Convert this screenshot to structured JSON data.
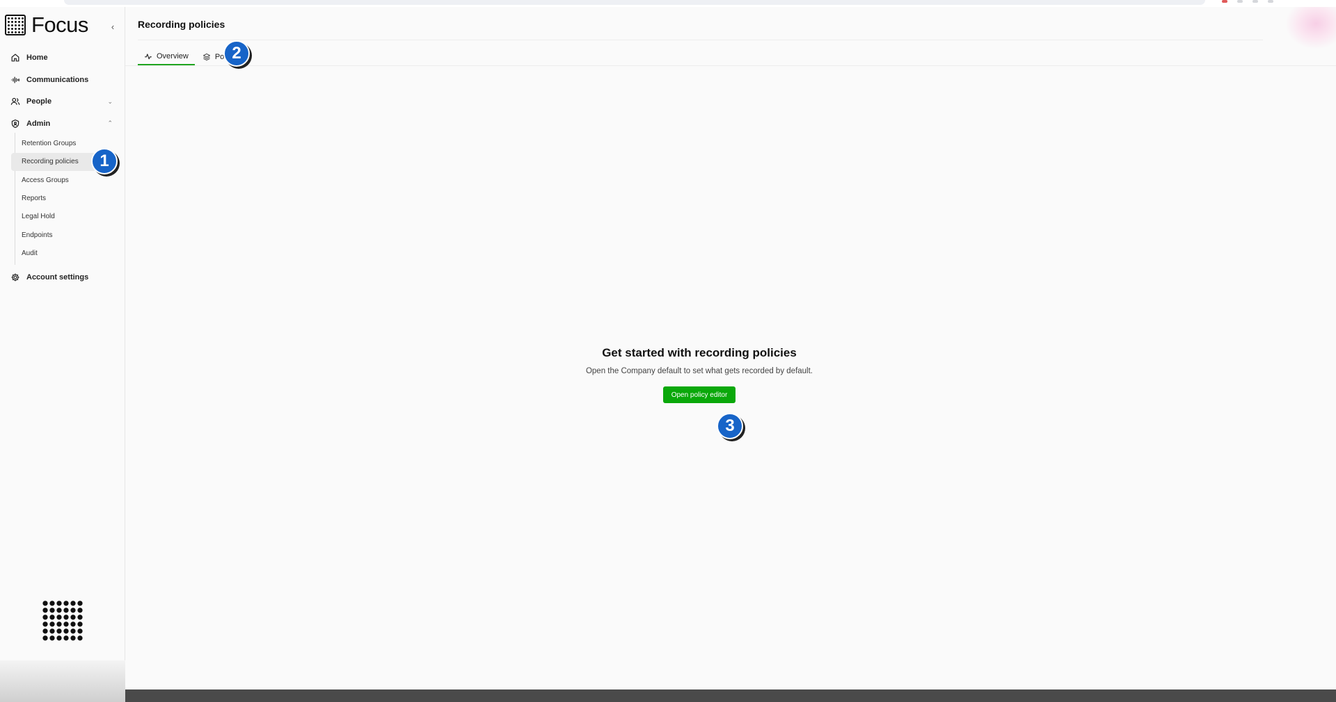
{
  "brand": {
    "name": "Focus"
  },
  "sidebar": {
    "collapse_glyph": "‹",
    "items": [
      {
        "id": "home",
        "label": "Home",
        "icon": "home-icon"
      },
      {
        "id": "communications",
        "label": "Communications",
        "icon": "waveform-icon"
      },
      {
        "id": "people",
        "label": "People",
        "icon": "users-icon",
        "chevron": "⌄"
      },
      {
        "id": "admin",
        "label": "Admin",
        "icon": "shield-icon",
        "chevron": "⌃"
      }
    ],
    "admin_subitems": [
      {
        "label": "Retention Groups",
        "active": false
      },
      {
        "label": "Recording policies",
        "active": true
      },
      {
        "label": "Access Groups",
        "active": false
      },
      {
        "label": "Reports",
        "active": false
      },
      {
        "label": "Legal Hold",
        "active": false
      },
      {
        "label": "Endpoints",
        "active": false
      },
      {
        "label": "Audit",
        "active": false
      }
    ],
    "account": {
      "label": "Account settings",
      "icon": "settings-icon"
    }
  },
  "page": {
    "title": "Recording policies",
    "tabs": [
      {
        "label": "Overview",
        "icon": "activity-icon",
        "active": true
      },
      {
        "label": "Po",
        "icon": "layers-icon",
        "active": false
      }
    ]
  },
  "empty_state": {
    "title": "Get started with recording policies",
    "description": "Open the Company default to set what gets recorded by default.",
    "button_label": "Open policy editor"
  },
  "step_markers": [
    {
      "number": "1",
      "target": "sidebar-item-recording-policies"
    },
    {
      "number": "2",
      "target": "tab-policies"
    },
    {
      "number": "3",
      "target": "open-policy-editor-button"
    }
  ],
  "colors": {
    "accent_green": "#0aa80a",
    "tab_underline": "#1fa51f",
    "step_marker_blue": "#1764c8",
    "active_item_bg": "#e9e9e9"
  }
}
